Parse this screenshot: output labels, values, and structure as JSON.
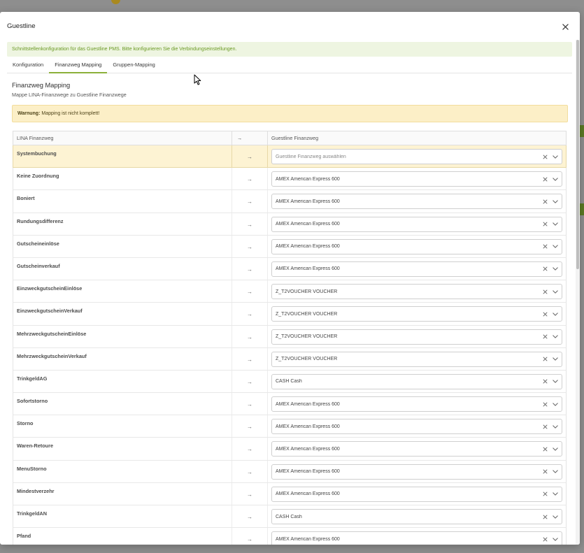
{
  "modal": {
    "title": "Guestline"
  },
  "info_message": "Schnittstellenkonfiguration für das Guestline PMS. Bitte konfigurieren Sie die Verbindungseinstellungen.",
  "tabs": [
    {
      "label": "Konfiguration",
      "active": false
    },
    {
      "label": "Finanzweg Mapping",
      "active": true
    },
    {
      "label": "Gruppen-Mapping",
      "active": false
    }
  ],
  "section": {
    "title": "Finanzweg Mapping",
    "subtitle": "Mappe LINA-Finanzwege zu Guestline Finanzwege"
  },
  "warning": {
    "label": "Warnung:",
    "text": "Mapping ist nicht komplett!"
  },
  "table": {
    "headers": {
      "lina": "LINA Finanzweg",
      "arrow": "→",
      "guestline": "Guestline Finanzweg"
    },
    "arrow": "→",
    "rows": [
      {
        "label": "Systembuchung",
        "placeholder": "Guestline Finanzweg auswählen",
        "highlighted": true
      },
      {
        "label": "Keine Zuordnung",
        "value": "AMEX American Express 600"
      },
      {
        "label": "Boniert",
        "value": "AMEX American Express 600"
      },
      {
        "label": "Rundungsdifferenz",
        "value": "AMEX American Express 600"
      },
      {
        "label": "Gutscheineinlöse",
        "value": "AMEX American Express 600"
      },
      {
        "label": "Gutscheinverkauf",
        "value": "AMEX American Express 600"
      },
      {
        "label": "EinzweckgutscheinEinlöse",
        "value": "Z_T2VOUCHER VOUCHER"
      },
      {
        "label": "EinzweckgutscheinVerkauf",
        "value": "Z_T2VOUCHER VOUCHER"
      },
      {
        "label": "MehrzweckgutscheinEinlöse",
        "value": "Z_T2VOUCHER VOUCHER"
      },
      {
        "label": "MehrzweckgutscheinVerkauf",
        "value": "Z_T2VOUCHER VOUCHER"
      },
      {
        "label": "TrinkgeldAG",
        "value": "CASH Cash"
      },
      {
        "label": "Sofortstorno",
        "value": "AMEX American Express 600"
      },
      {
        "label": "Storno",
        "value": "AMEX American Express 600"
      },
      {
        "label": "Waren-Retoure",
        "value": "AMEX American Express 600"
      },
      {
        "label": "MenuStorno",
        "value": "AMEX American Express 600"
      },
      {
        "label": "Mindestverzehr",
        "value": "AMEX American Express 600"
      },
      {
        "label": "TrinkgeldAN",
        "value": "CASH Cash"
      },
      {
        "label": "Pfand",
        "value": "AMEX American Express 600"
      }
    ]
  },
  "colors": {
    "accent": "#8bb03a",
    "info_background": "#eef5e1",
    "info_text": "#6b9a25",
    "warning_background": "#fcefc7",
    "unmapped_row": "#fdf3d3",
    "backdrop": "#8e8e8e"
  },
  "icons": {
    "close": "close-icon",
    "clear_value": "clear-icon",
    "dropdown": "chevron-down-icon",
    "pointer": "mouse-pointer-icon"
  }
}
